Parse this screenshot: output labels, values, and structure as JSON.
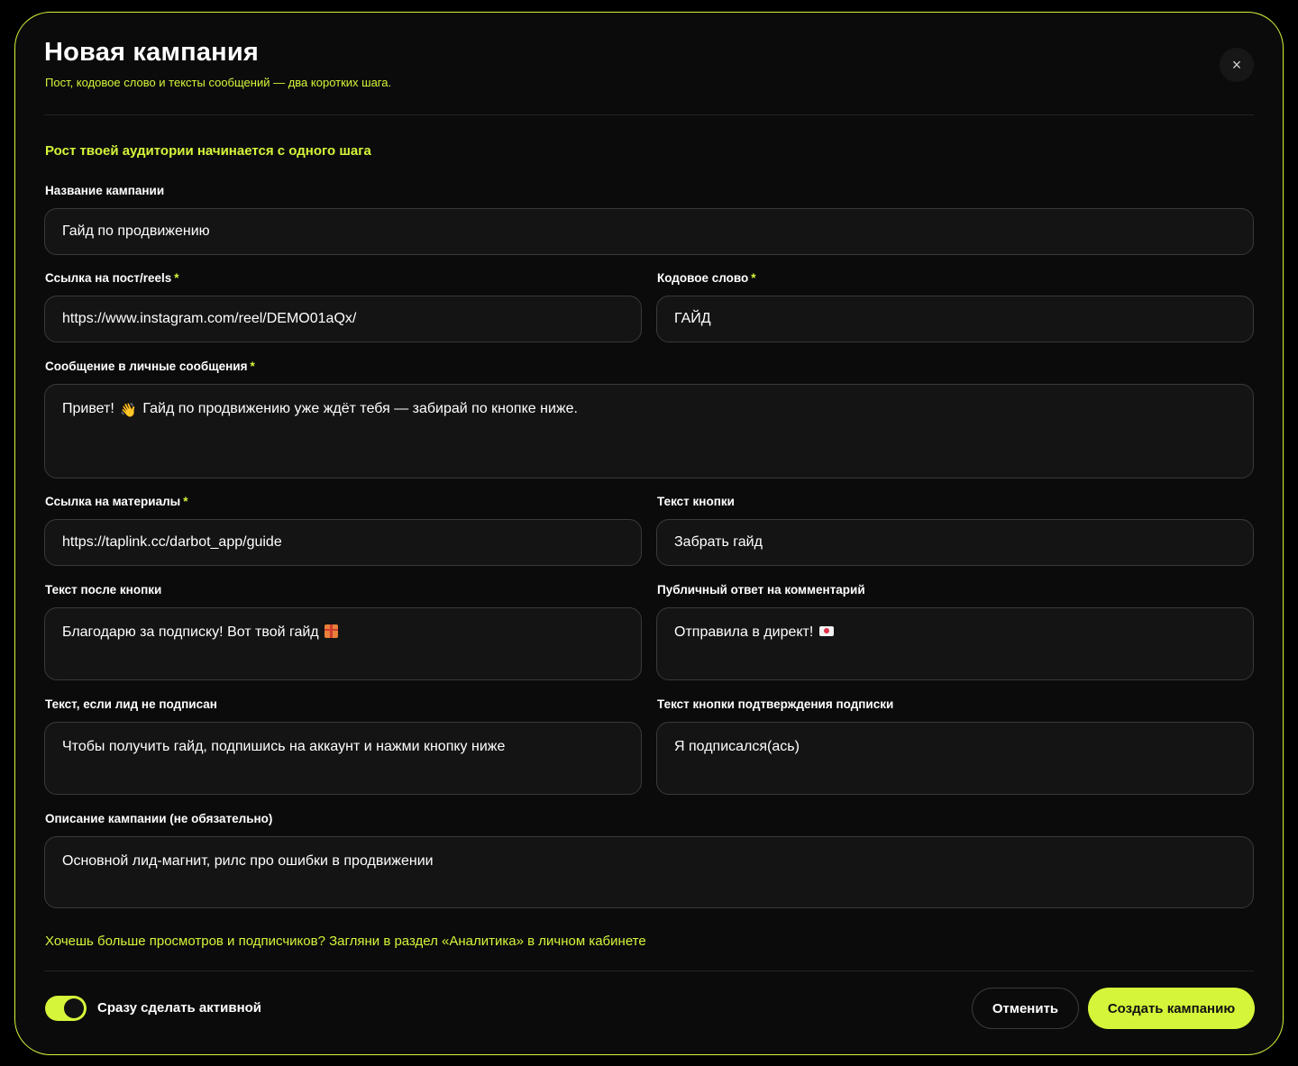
{
  "header": {
    "title": "Новая кампания",
    "subtitle": "Пост, кодовое слово и тексты сообщений — два коротких шага.",
    "close_icon": "×"
  },
  "tagline": "Рост твоей аудитории начинается с одного шага",
  "required_mark": "*",
  "fields": {
    "campaign_name": {
      "label": "Название кампании",
      "value": "Гайд по продвижению"
    },
    "post_link": {
      "label": "Ссылка на пост/reels",
      "value": "https://www.instagram.com/reel/DEMO01aQx/"
    },
    "keyword": {
      "label": "Кодовое слово",
      "value": "ГАЙД"
    },
    "dm_message": {
      "label": "Сообщение в личные сообщения",
      "value_before": "Привет!",
      "emoji": "👋",
      "value_after": "Гайд по продвижению уже ждёт тебя — забирай по кнопке ниже."
    },
    "materials_link": {
      "label": "Ссылка на материалы",
      "value": "https://taplink.cc/darbot_app/guide"
    },
    "button_text": {
      "label": "Текст кнопки",
      "value": "Забрать гайд"
    },
    "after_button_text": {
      "label": "Текст после кнопки",
      "value": "Благодарю за подписку! Вот твой гайд",
      "emoji_icon": "gift-icon"
    },
    "public_reply": {
      "label": "Публичный ответ на комментарий",
      "value": "Отправила в директ!",
      "emoji_icon": "love-letter-icon"
    },
    "not_subscribed_text": {
      "label": "Текст, если лид не подписан",
      "value": "Чтобы получить гайд, подпишись на аккаунт и нажми кнопку ниже"
    },
    "confirm_button_text": {
      "label": "Текст кнопки подтверждения подписки",
      "value": "Я подписался(ась)"
    },
    "description": {
      "label": "Описание кампании (не обязательно)",
      "value": "Основной лид-магнит, рилс про ошибки в продвижении"
    }
  },
  "promo": "Хочешь больше просмотров и подписчиков? Загляни в раздел «Аналитика» в личном кабинете",
  "footer": {
    "toggle_label": "Сразу сделать активной",
    "toggle_on": true,
    "cancel_label": "Отменить",
    "create_label": "Создать кампанию"
  },
  "colors": {
    "accent": "#d4f53a",
    "background": "#0b0b0b",
    "field_bg": "#141414",
    "field_border": "#3a3a3a"
  }
}
